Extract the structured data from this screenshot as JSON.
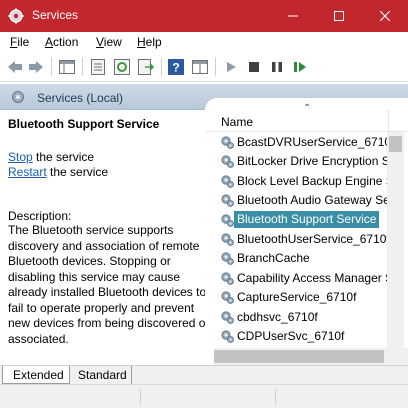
{
  "window": {
    "title": "Services",
    "accent": "#c1272d"
  },
  "menu": {
    "items": [
      "File",
      "Action",
      "View",
      "Help"
    ]
  },
  "toolbar": {
    "icons": [
      "back-icon",
      "forward-icon",
      "console-tree-icon",
      "properties-icon",
      "refresh-icon",
      "export-icon",
      "help-icon",
      "mmc-icon",
      "start-icon",
      "stop-icon",
      "pause-icon",
      "restart-icon"
    ]
  },
  "scope": {
    "label": "Services (Local)"
  },
  "detail": {
    "service_name": "Bluetooth Support Service",
    "stop_link": "Stop",
    "stop_suffix": " the service",
    "restart_link": "Restart",
    "restart_suffix": " the service",
    "description_label": "Description:",
    "description": "The Bluetooth service supports discovery and association of remote Bluetooth devices.  Stopping or disabling this service may cause already installed Bluetooth devices to fail to operate properly and prevent new devices from being discovered or associated."
  },
  "list": {
    "column_name": "Name",
    "selected_color": "#3a8fa7",
    "rows": [
      {
        "name": "BcastDVRUserService_6710f"
      },
      {
        "name": "BitLocker Drive Encryption S..."
      },
      {
        "name": "Block Level Backup Engine S..."
      },
      {
        "name": "Bluetooth Audio Gateway Se..."
      },
      {
        "name": "Bluetooth Support Service",
        "selected": true
      },
      {
        "name": "BluetoothUserService_6710f"
      },
      {
        "name": "BranchCache"
      },
      {
        "name": "Capability Access Manager S..."
      },
      {
        "name": "CaptureService_6710f"
      },
      {
        "name": "cbdhsvc_6710f"
      },
      {
        "name": "CDPUserSvc_6710f"
      }
    ]
  },
  "tabs": {
    "extended": "Extended",
    "standard": "Standard"
  }
}
